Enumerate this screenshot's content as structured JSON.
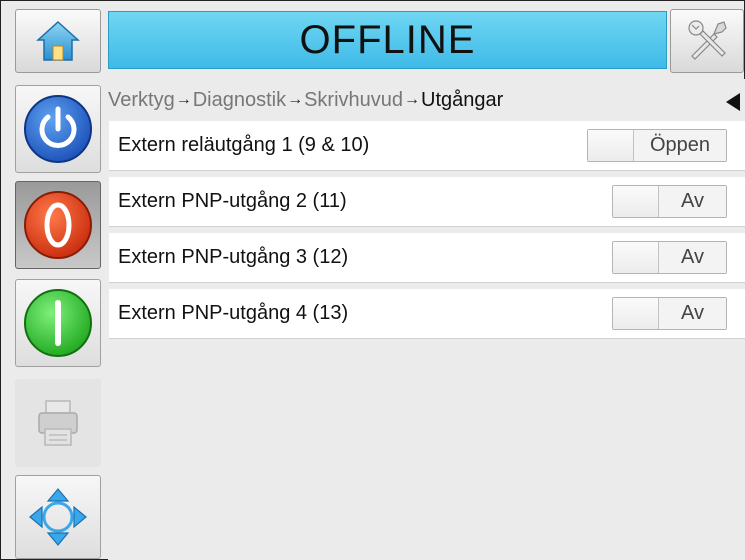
{
  "status": {
    "text": "OFFLINE",
    "color": "#4cc4ec"
  },
  "breadcrumb": {
    "items": [
      "Verktyg",
      "Diagnostik",
      "Skrivhuvud",
      "Utgångar"
    ],
    "separator": "→"
  },
  "outputs": [
    {
      "label": "Extern reläutgång 1 (9 & 10)",
      "state": "Öppen"
    },
    {
      "label": "Extern PNP-utgång 2 (11)",
      "state": "Av"
    },
    {
      "label": "Extern PNP-utgång 3 (12)",
      "state": "Av"
    },
    {
      "label": "Extern PNP-utgång 4 (13)",
      "state": "Av"
    }
  ],
  "icons": {
    "home": "home-icon",
    "tools": "tools-icon",
    "power": "power-icon",
    "stop": "stop-icon",
    "start": "start-icon",
    "print": "printer-icon",
    "navigate": "navigation-arrows-icon",
    "back": "back-arrow-icon"
  },
  "colors": {
    "power": "#2f6fd6",
    "stop": "#e0401a",
    "start": "#2fc42f"
  }
}
